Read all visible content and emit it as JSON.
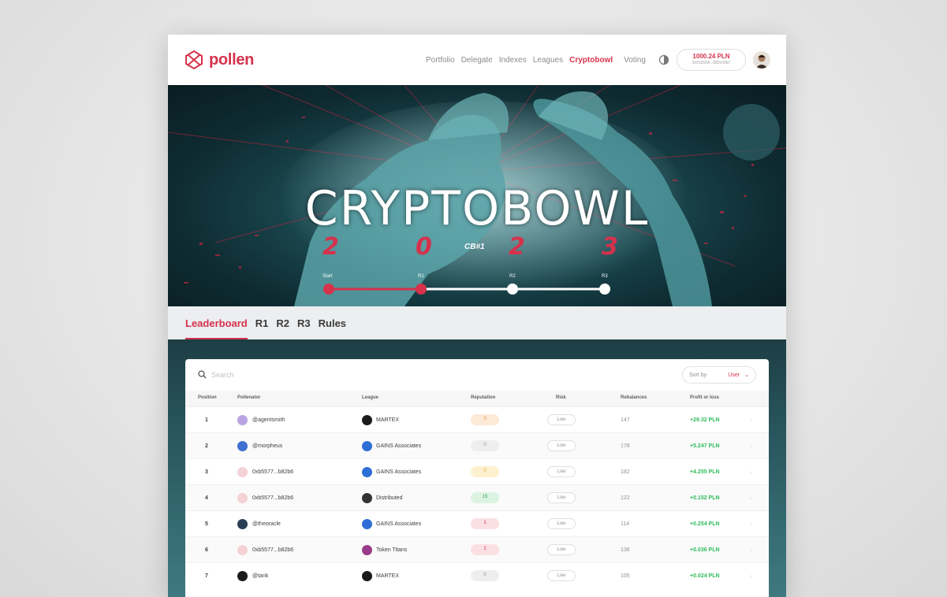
{
  "nav": {
    "brand": "pollen",
    "links": [
      {
        "label": "Portfolio",
        "active": false
      },
      {
        "label": "Delegate",
        "active": false
      },
      {
        "label": "Indexes",
        "active": false
      },
      {
        "label": "Leagues",
        "active": false
      },
      {
        "label": "Cryptobowl",
        "active": true
      },
      {
        "label": "Voting",
        "active": false
      }
    ],
    "wallet": {
      "balance": "1000.24 PLN",
      "address": "0x91055A...882c43b7"
    },
    "icons": [
      "pollen-logo-icon",
      "theme-toggle-icon",
      "user-avatar"
    ]
  },
  "hero": {
    "title": "CRYPTOBOWL",
    "year_digits": [
      "2",
      "0",
      "2",
      "3"
    ],
    "subtitle": "CB#1",
    "timeline": {
      "labels": [
        "Start",
        "R1",
        "R2",
        "R3"
      ],
      "progress": 0.33
    }
  },
  "tabs": [
    {
      "label": "Leaderboard",
      "active": true
    },
    {
      "label": "R1",
      "active": false
    },
    {
      "label": "R2",
      "active": false
    },
    {
      "label": "R3",
      "active": false
    },
    {
      "label": "Rules",
      "active": false
    }
  ],
  "leaderboard": {
    "search_placeholder": "Search",
    "sort": {
      "label": "Sort by",
      "value": "User"
    },
    "columns": [
      "Position",
      "Pollenator",
      "League",
      "Reputation",
      "Risk",
      "Rebalances",
      "Profit or loss"
    ],
    "rows": [
      {
        "position": "1",
        "pollenator": "@agentsmith",
        "league": "MARTEX",
        "reputation": "3",
        "risk": "Low",
        "rebalances": "147",
        "pnl": "+29.32 PLN",
        "rep_color": "#fde9d6",
        "rep_text": "#e89a55",
        "pav_color": "#b9a3e0",
        "lav_color": "#1a1a1a"
      },
      {
        "position": "2",
        "pollenator": "@morpheus",
        "league": "GAINS Associates",
        "reputation": "0",
        "risk": "Low",
        "rebalances": "178",
        "pnl": "+5.247 PLN",
        "rep_color": "#eeeeee",
        "rep_text": "#909090",
        "pav_color": "#3f6fd0",
        "lav_color": "#2d6fd6"
      },
      {
        "position": "3",
        "pollenator": "0xb5577...b82b6",
        "league": "GAINS Associates",
        "reputation": "5",
        "risk": "Low",
        "rebalances": "182",
        "pnl": "+4.255 PLN",
        "rep_color": "#fdf1cf",
        "rep_text": "#e2b33f",
        "pav_color": "#f4d2d6",
        "lav_color": "#2d6fd6"
      },
      {
        "position": "4",
        "pollenator": "0xb5577...b82b6",
        "league": "Distributed",
        "reputation": "15",
        "risk": "Low",
        "rebalances": "122",
        "pnl": "+0.152 PLN",
        "rep_color": "#dcf3e2",
        "rep_text": "#3aa860",
        "pav_color": "#f4d2d6",
        "lav_color": "#333333"
      },
      {
        "position": "5",
        "pollenator": "@theoracle",
        "league": "GAINS Associates",
        "reputation": "1",
        "risk": "Low",
        "rebalances": "114",
        "pnl": "+0.254 PLN",
        "rep_color": "#fbe0e3",
        "rep_text": "#d6324c",
        "pav_color": "#2a3f55",
        "lav_color": "#2d6fd6"
      },
      {
        "position": "6",
        "pollenator": "0xb5577...b82b6",
        "league": "Token Titans",
        "reputation": "1",
        "risk": "Low",
        "rebalances": "136",
        "pnl": "+0.036 PLN",
        "rep_color": "#fbe0e3",
        "rep_text": "#d6324c",
        "pav_color": "#f4d2d6",
        "lav_color": "#9a3a8a"
      },
      {
        "position": "7",
        "pollenator": "@tank",
        "league": "MARTEX",
        "reputation": "0",
        "risk": "Low",
        "rebalances": "105",
        "pnl": "+0.024 PLN",
        "rep_color": "#eeeeee",
        "rep_text": "#909090",
        "pav_color": "#1a1a1a",
        "lav_color": "#1a1a1a"
      }
    ]
  },
  "colors": {
    "brand": "#d6324c",
    "profit": "#2fbb5a",
    "hero_teal": "#3a7b84"
  }
}
